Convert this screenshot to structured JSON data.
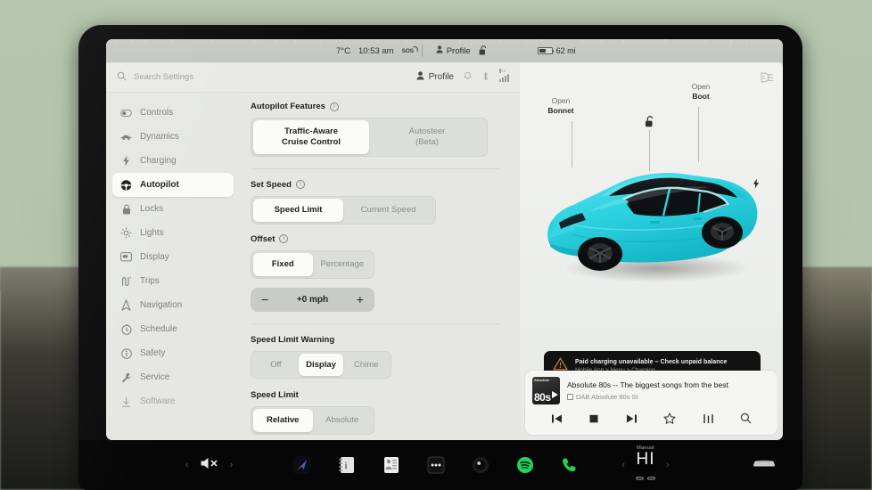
{
  "status_bar": {
    "temperature": "7°C",
    "time": "10:53 am",
    "sos": "SOS",
    "profile": "Profile",
    "lock_icon": "unlock-icon",
    "range": "62 mi"
  },
  "settings_header": {
    "search_placeholder": "Search Settings",
    "search_value": "",
    "profile": "Profile",
    "icons": [
      "bell-icon",
      "bluetooth-icon",
      "lte-signal-icon"
    ],
    "lte_label": "LTE"
  },
  "sidebar": {
    "items": [
      {
        "label": "Controls",
        "icon": "toggle-icon",
        "active": false
      },
      {
        "label": "Dynamics",
        "icon": "car-side-icon",
        "active": false
      },
      {
        "label": "Charging",
        "icon": "bolt-icon",
        "active": false
      },
      {
        "label": "Autopilot",
        "icon": "steering-wheel-icon",
        "active": true
      },
      {
        "label": "Locks",
        "icon": "lock-icon",
        "active": false
      },
      {
        "label": "Lights",
        "icon": "sun-icon",
        "active": false
      },
      {
        "label": "Display",
        "icon": "display-icon",
        "active": false
      },
      {
        "label": "Trips",
        "icon": "road-icon",
        "active": false
      },
      {
        "label": "Navigation",
        "icon": "navigation-arrow-icon",
        "active": false
      },
      {
        "label": "Schedule",
        "icon": "clock-icon",
        "active": false
      },
      {
        "label": "Safety",
        "icon": "info-circle-icon",
        "active": false
      },
      {
        "label": "Service",
        "icon": "wrench-icon",
        "active": false
      },
      {
        "label": "Software",
        "icon": "download-icon",
        "active": false
      }
    ]
  },
  "autopilot": {
    "features": {
      "label": "Autopilot Features",
      "options": [
        {
          "label": "Traffic-Aware\nCruise Control",
          "line1": "Traffic-Aware",
          "line2": "Cruise Control",
          "selected": true
        },
        {
          "label": "Autosteer\n(Beta)",
          "line1": "Autosteer",
          "line2": "(Beta)",
          "selected": false
        }
      ]
    },
    "set_speed": {
      "label": "Set Speed",
      "options": [
        {
          "label": "Speed Limit",
          "selected": true
        },
        {
          "label": "Current Speed",
          "selected": false
        }
      ]
    },
    "offset": {
      "label": "Offset",
      "options": [
        {
          "label": "Fixed",
          "selected": true
        },
        {
          "label": "Percentage",
          "selected": false
        }
      ],
      "stepper": {
        "minus": "−",
        "value": "+0 mph",
        "plus": "+"
      }
    },
    "speed_limit_warning": {
      "label": "Speed Limit Warning",
      "options": [
        {
          "label": "Off",
          "selected": false
        },
        {
          "label": "Display",
          "selected": true
        },
        {
          "label": "Chime",
          "selected": false
        }
      ]
    },
    "speed_limit": {
      "label": "Speed Limit",
      "options": [
        {
          "label": "Relative",
          "selected": true
        },
        {
          "label": "Absolute",
          "selected": false
        }
      ]
    }
  },
  "car_panel": {
    "headlight_icon": "auto-headlight-icon",
    "unlock_icon": "unlock-icon",
    "charge_port_icon": "charge-bolt-icon",
    "open_bonnet": {
      "line1": "Open",
      "line2": "Bonnet"
    },
    "open_boot": {
      "line1": "Open",
      "line2": "Boot"
    },
    "car_color": "#2ed3e0"
  },
  "alert": {
    "icon": "warning-triangle-icon",
    "title": "Paid charging unavailable – Check unpaid balance",
    "subtitle": "Mobile App > Menu > Charging"
  },
  "media": {
    "album_art": {
      "line1": "Absolute",
      "line2": "80s"
    },
    "title": "Absolute 80s -- The biggest songs from the best",
    "source": "DAB Absolute 80s St",
    "badge": "DAB",
    "controls": [
      {
        "name": "previous-track-button",
        "glyph": "prev"
      },
      {
        "name": "stop-button",
        "glyph": "stop"
      },
      {
        "name": "next-track-button",
        "glyph": "next"
      },
      {
        "name": "favorite-button",
        "glyph": "star"
      },
      {
        "name": "equalizer-button",
        "glyph": "eq"
      },
      {
        "name": "search-media-button",
        "glyph": "search"
      }
    ]
  },
  "app_bar": {
    "volume": {
      "icon": "volume-mute-icon",
      "prev": "‹",
      "next": "›"
    },
    "apps": [
      {
        "name": "app-navigation",
        "label": ""
      },
      {
        "name": "app-notes",
        "label": ""
      },
      {
        "name": "app-calendar",
        "label": ""
      },
      {
        "name": "app-more",
        "label": ""
      },
      {
        "name": "app-camera",
        "label": ""
      },
      {
        "name": "app-spotify",
        "label": ""
      },
      {
        "name": "app-phone",
        "label": ""
      }
    ],
    "climate": {
      "mode": "Manual",
      "temp": "HI",
      "prev": "‹",
      "next": "›",
      "seat_left_icon": "seat-heater-icon",
      "seat_right_icon": "seat-heater-icon"
    },
    "car_icon": "car-front-icon"
  },
  "colors": {
    "accent_car": "#2ed3e0",
    "spotify_green": "#1ed760",
    "alert_bg": "#121212",
    "panel_bg": "#e6e7e3"
  }
}
